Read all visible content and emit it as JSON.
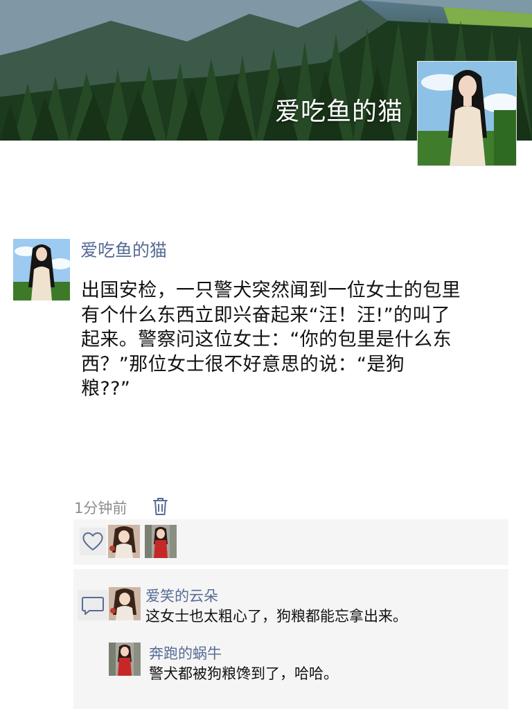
{
  "profile": {
    "cover_name": "爱吃鱼的猫"
  },
  "post": {
    "author": "爱吃鱼的猫",
    "lines": [
      "出国安检，一只警犬突然闻到一位女士的包里",
      "有个什么东西立即兴奋起来“汪！汪!”的叫了",
      "起来。警察问这位女士：“你的包里是什么东",
      "西？”那位女士很不好意思的说：“是狗",
      "粮??”"
    ],
    "time": "1分钟前"
  },
  "icons": {
    "delete": "trash-icon",
    "like": "heart-outline-icon",
    "comment": "comment-bubble-icon"
  },
  "likes": {
    "count": 2
  },
  "comments": [
    {
      "author": "爱笑的云朵",
      "text": "这女士也太粗心了，狗粮都能忘拿出来。"
    },
    {
      "author": "奔跑的蜗牛",
      "text": "警犬都被狗粮馋到了，哈哈。"
    }
  ],
  "colors": {
    "link_blue": "#576b95",
    "panel_bg": "#f5f5f5",
    "text": "#111111",
    "meta": "#8c8c8c"
  }
}
